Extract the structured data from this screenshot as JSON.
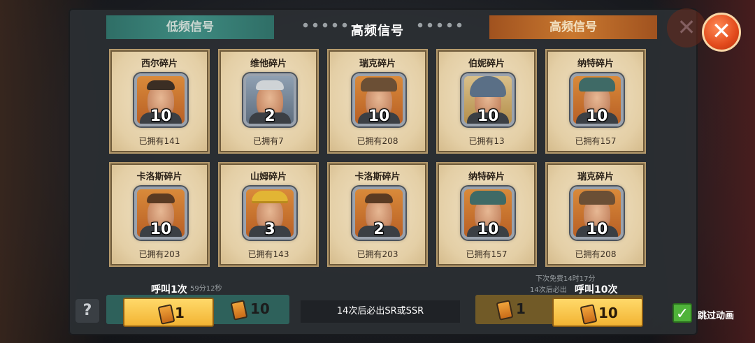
{
  "dialog": {
    "title": "高频信号",
    "bg_tab_left": "低频信号",
    "bg_tab_right": "高频信号",
    "close_icon": "✕"
  },
  "cards": [
    {
      "name": "西尔碎片",
      "count": "10",
      "owned": "已拥有141",
      "hat": "none",
      "hat_color": "#3b2e24"
    },
    {
      "name": "维他碎片",
      "count": "2",
      "owned": "已拥有7",
      "hat": "none",
      "hat_color": "#cfd3d6"
    },
    {
      "name": "瑞克碎片",
      "count": "10",
      "owned": "已拥有208",
      "hat": "cap",
      "hat_color": "#6b4f35"
    },
    {
      "name": "伯妮碎片",
      "count": "10",
      "owned": "已拥有13",
      "hat": "helmet",
      "hat_color": "#5a6f86"
    },
    {
      "name": "纳特碎片",
      "count": "10",
      "owned": "已拥有157",
      "hat": "cap",
      "hat_color": "#3f6a66"
    },
    {
      "name": "卡洛斯碎片",
      "count": "10",
      "owned": "已拥有203",
      "hat": "none",
      "hat_color": "#5a3a22"
    },
    {
      "name": "山姆碎片",
      "count": "3",
      "owned": "已拥有143",
      "hat": "hardhat",
      "hat_color": "#e2b534"
    },
    {
      "name": "卡洛斯碎片",
      "count": "2",
      "owned": "已拥有203",
      "hat": "none",
      "hat_color": "#5a3a22"
    },
    {
      "name": "纳特碎片",
      "count": "10",
      "owned": "已拥有157",
      "hat": "cap",
      "hat_color": "#3f6a66"
    },
    {
      "name": "瑞克碎片",
      "count": "10",
      "owned": "已拥有208",
      "hat": "cap",
      "hat_color": "#6b4f35"
    }
  ],
  "bottom": {
    "call_once_label": "呼叫1次",
    "call_once_qty": "1",
    "call_ten_label": "呼叫10次",
    "call_ten_qty": "10",
    "center_text": "14次后必出SR或SSR",
    "bg_left_teal_qty": "10",
    "bg_right_dim_qty": "1",
    "bg_timer_left": "59分12秒",
    "bg_next_free": "下次免费14时17分",
    "bg_guarantee": "14次后必出",
    "skip_label": "跳过动画",
    "help_label": "?",
    "check_icon": "✓"
  },
  "colors": {
    "accent_yellow": "#f2b433",
    "close_orange": "#e24a1c",
    "card_parchment": "#e4cfa6",
    "check_green": "#4fb33a"
  }
}
